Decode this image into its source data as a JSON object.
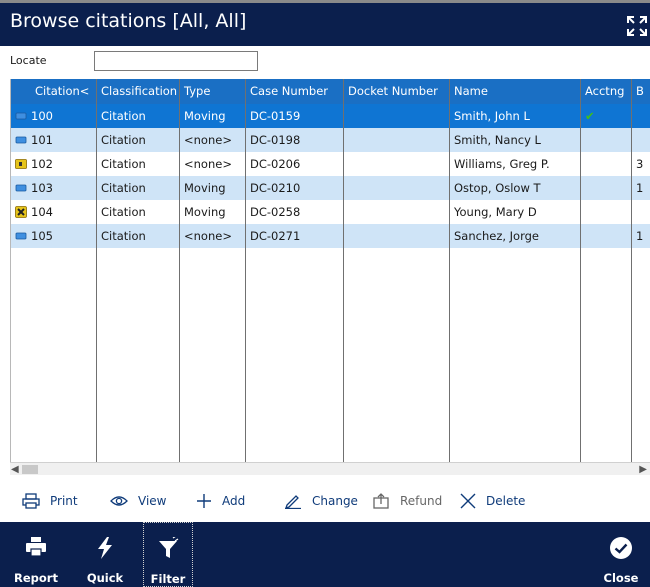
{
  "window": {
    "title": "Browse citations [All, All]"
  },
  "locate": {
    "label": "Locate",
    "value": ""
  },
  "grid": {
    "columns": [
      "Citation<",
      "Classification",
      "Type",
      "Case Number",
      "Docket Number",
      "Name",
      "Acctng",
      "B"
    ],
    "rows": [
      {
        "citation": "100",
        "classification": "Citation",
        "type": "Moving",
        "case_number": "DC-0159",
        "docket_number": "",
        "name": "Smith, John L",
        "acctng": "✔",
        "b": "",
        "icon": "folder-blue-icon"
      },
      {
        "citation": "101",
        "classification": "Citation",
        "type": "<none>",
        "case_number": "DC-0198",
        "docket_number": "",
        "name": "Smith, Nancy L",
        "acctng": "",
        "b": "",
        "icon": "folder-blue-icon"
      },
      {
        "citation": "102",
        "classification": "Citation",
        "type": "<none>",
        "case_number": "DC-0206",
        "docket_number": "",
        "name": "Williams, Greg P.",
        "acctng": "",
        "b": "3",
        "icon": "folder-yellow-icon"
      },
      {
        "citation": "103",
        "classification": "Citation",
        "type": "Moving",
        "case_number": "DC-0210",
        "docket_number": "",
        "name": "Ostop, Oslow T",
        "acctng": "",
        "b": "1",
        "icon": "folder-blue-icon"
      },
      {
        "citation": "104",
        "classification": "Citation",
        "type": "Moving",
        "case_number": "DC-0258",
        "docket_number": "",
        "name": "Young, Mary D",
        "acctng": "",
        "b": "",
        "icon": "folder-x-icon"
      },
      {
        "citation": "105",
        "classification": "Citation",
        "type": "<none>",
        "case_number": "DC-0271",
        "docket_number": "",
        "name": "Sanchez, Jorge",
        "acctng": "",
        "b": "1",
        "icon": "folder-blue-icon"
      }
    ]
  },
  "actions": {
    "print": "Print",
    "view": "View",
    "add": "Add",
    "change": "Change",
    "refund": "Refund",
    "delete": "Delete"
  },
  "bottombar": {
    "report": "Report",
    "quick": "Quick",
    "filter": "Filter",
    "close": "Close"
  },
  "colors": {
    "titlebar": "#0b1f4d",
    "header": "#1a6fc4",
    "selected_row": "#0f75d3",
    "alt_row": "#cfe4f7",
    "check": "#3fbf1a"
  }
}
